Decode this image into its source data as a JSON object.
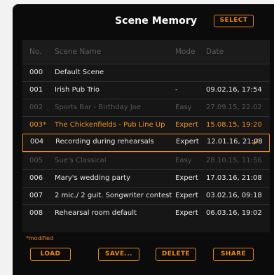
{
  "header": {
    "title": "Scene Memory",
    "select_label": "SELECT"
  },
  "table": {
    "columns": {
      "no": "No.",
      "name": "Scene Name",
      "mode": "Mode",
      "date": "Date"
    },
    "rows": [
      {
        "no": "000",
        "name": "Default Scene",
        "mode": "",
        "date": "",
        "state": "normal"
      },
      {
        "no": "001",
        "name": "Irish Pub Trio",
        "mode": "-",
        "date": "09.02.16, 17:54",
        "state": "normal"
      },
      {
        "no": "002",
        "name": "Sports Bar - Birthday Joe",
        "mode": "Easy",
        "date": "27.09.15, 22:02",
        "state": "dim"
      },
      {
        "no": "003*",
        "name": "The Chickenfields - Pub Line Up",
        "mode": "Expert",
        "date": "15.08.15, 19:20",
        "state": "modified"
      },
      {
        "no": "004",
        "name": "Recording during rehearsals",
        "mode": "Expert",
        "date": "12.01.16, 21:08",
        "state": "selected"
      },
      {
        "no": "005",
        "name": "Sue's Classical",
        "mode": "Easy",
        "date": "28.10.15, 11:56",
        "state": "dim"
      },
      {
        "no": "006",
        "name": "Mary's wedding party",
        "mode": "Expert",
        "date": "17.03.16, 21:08",
        "state": "normal"
      },
      {
        "no": "007",
        "name": "2 mic./ 2 guit. Songwriter contest",
        "mode": "Expert",
        "date": "03.02.16, 09:18",
        "state": "normal"
      },
      {
        "no": "008",
        "name": "Rehearsal room default",
        "mode": "Expert",
        "date": "06.03.16, 19:02",
        "state": "normal"
      }
    ],
    "selected_icon": "checkmark-icon",
    "check_glyph": "✓"
  },
  "footnote": "*modified",
  "actions": {
    "load": "LOAD",
    "save": "SAVE...",
    "delete": "DELETE",
    "share": "SHARE"
  },
  "colors": {
    "accent": "#f08a10",
    "background": "#0b0b0b",
    "text": "#e8e8e8",
    "dim_text": "#575757"
  }
}
